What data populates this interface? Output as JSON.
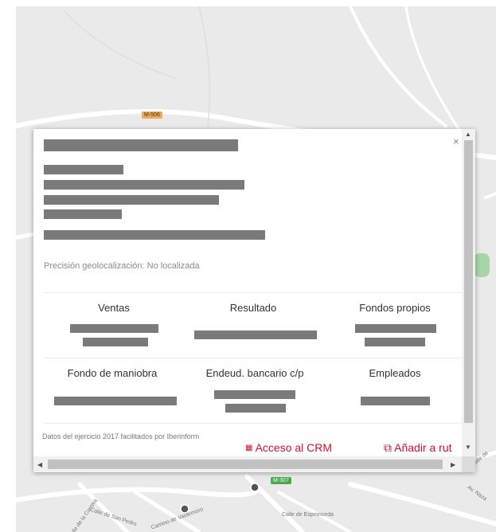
{
  "map": {
    "road_labels": {
      "m506": "M-506",
      "m307": "M-307"
    },
    "streets": {
      "calle_san_pedro": "Calle de San Pedro",
      "camino_valdemoro": "Camino de Valdemoro",
      "calle_espronceda": "Calle de Espronceda",
      "av_nazaret": "Av. Naza",
      "carrera": "Calle de la Carrera",
      "calle_de": "Calle de"
    },
    "colors": {
      "map_bg": "#eaeaea",
      "road": "#ffffff",
      "road_label_orange": "#f0a958",
      "road_label_green": "#4ca64c"
    }
  },
  "popup": {
    "precision_text": "Precisión geolocalización: No localizada",
    "metrics": {
      "ventas": "Ventas",
      "resultado": "Resultado",
      "fondos_propios": "Fondos propios",
      "fondo_maniobra": "Fondo de maniobra",
      "endeudamiento": "Endeud. bancario c/p",
      "empleados": "Empleados"
    },
    "footer_note": "Datos del ejercicio 2017 facilitados por Iberinform",
    "crm_icon": "grid-icon",
    "crm_label": "Acceso al CRM",
    "route_icon": "route-pin-icon",
    "route_label": "Añadir a rut",
    "close_icon": "close-icon",
    "close_glyph": "×",
    "accent_color": "#d2102c"
  }
}
